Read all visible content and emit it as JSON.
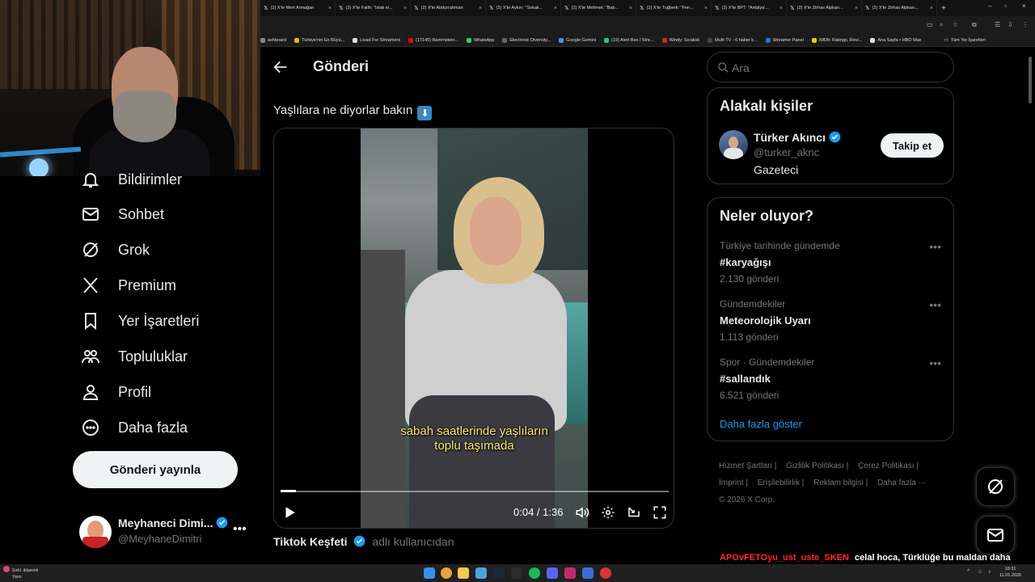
{
  "colors": {
    "background": "#000000",
    "text_primary": "#e7e9ea",
    "text_secondary": "#71767b",
    "accent": "#1d9bf0",
    "caption_yellow": "#f5e96b",
    "chat_user": "#ff2a2a"
  },
  "browser": {
    "tabs": [
      {
        "icon": "x-icon",
        "title": "(2) X'te Mert Armağan"
      },
      {
        "icon": "x-icon",
        "title": "(2) X'te Fatih: \"Islak ei..."
      },
      {
        "icon": "x-icon",
        "title": "(2) X'te Abdurrahman"
      },
      {
        "icon": "x-icon",
        "title": "(2) X'te Aykırı: \"Sokak..."
      },
      {
        "icon": "x-icon",
        "title": "(2) X'te Mehmet: \"Bab..."
      },
      {
        "icon": "x-icon",
        "title": "(2) X'te Tuğberk: \"Fen..."
      },
      {
        "icon": "x-icon",
        "title": "(2) X'te BPT: \"Antalya'..."
      },
      {
        "icon": "x-icon",
        "title": "(2) X'te Zirhas Alpkan..."
      },
      {
        "icon": "x-icon",
        "title": "(2) X'te Zirhas Alpkan..."
      }
    ],
    "bookmarks": [
      {
        "label": "ashboard",
        "color": "#888888"
      },
      {
        "label": "Türkiye'nin En Büyü...",
        "color": "#f5b400"
      },
      {
        "label": "Livad For Streamers",
        "color": "#dddddd"
      },
      {
        "label": "(17145) Rammstein...",
        "color": "#ff0000"
      },
      {
        "label": "WhatsApp",
        "color": "#25d366"
      },
      {
        "label": "Electronic Diversity...",
        "color": "#666666"
      },
      {
        "label": "Google Gemini",
        "color": "#4f8df5"
      },
      {
        "label": "(19) Alert Box / Stre...",
        "color": "#31c27c"
      },
      {
        "label": "Windy: Sıcaklık",
        "color": "#d22"
      },
      {
        "label": "Multi TV - 6 haber k...",
        "color": "#444444"
      },
      {
        "label": "Streamer Panel",
        "color": "#2a6de0"
      },
      {
        "label": "IMDb: Ratings, Revi...",
        "color": "#f5c518"
      },
      {
        "label": "Ana Sayfa • HBO Max",
        "color": "#dddddd"
      }
    ],
    "all_bookmarks_label": "Tüm Yer İşaretleri"
  },
  "nav": {
    "items": [
      {
        "label": "Bildirimler",
        "icon": "bell-icon"
      },
      {
        "label": "Sohbet",
        "icon": "mail-icon"
      },
      {
        "label": "Grok",
        "icon": "grok-icon"
      },
      {
        "label": "Premium",
        "icon": "x-logo-icon"
      },
      {
        "label": "Yer İşaretleri",
        "icon": "bookmark-icon"
      },
      {
        "label": "Topluluklar",
        "icon": "communities-icon"
      },
      {
        "label": "Profil",
        "icon": "person-icon"
      },
      {
        "label": "Daha fazla",
        "icon": "more-circle-icon"
      }
    ],
    "post_button": "Gönderi yayınla",
    "account": {
      "name": "Meyhaneci Dimi...",
      "handle": "@MeyhaneDimitri",
      "avatar_text": "DIMITRI"
    }
  },
  "main": {
    "title": "Gönderi",
    "tweet_text": "Yaşlılara ne diyorlar bakın",
    "tweet_emoji": "⬇",
    "video": {
      "caption_line1": "sabah saatlerinde yaşlıların",
      "caption_line2": "toplu taşımada",
      "time": "0:04 / 1:36",
      "progress": 0.04
    },
    "source": {
      "name": "Tiktok Keşfeti",
      "suffix": "adlı kullanıcıdan"
    }
  },
  "sidebar": {
    "search_placeholder": "Ara",
    "relevant": {
      "title": "Alakalı kişiler",
      "name": "Türker Akıncı",
      "handle": "@turker_aknc",
      "bio": "Gazeteci",
      "follow_label": "Takip et"
    },
    "trends": {
      "title": "Neler oluyor?",
      "items": [
        {
          "context": "Türkiye tarihinde gündemde",
          "name": "#karyağışı",
          "count": "2.130 gönderi"
        },
        {
          "context": "Gündemdekiler",
          "name": "Meteorolojik Uyarı",
          "count": "1.113 gönderi"
        },
        {
          "context": "Spor · Gündemdekiler",
          "name": "#sallandık",
          "count": "6.521 gönderi"
        }
      ],
      "show_more": "Daha fazla göster"
    },
    "footer": [
      "Hizmet Şartları |",
      "Gizlilik Politikası |",
      "Çerez Politikası |",
      "Imprint |",
      "Erişilebilirlik |",
      "Reklam bilgisi |",
      "Daha fazla ···",
      "© 2026 X Corp."
    ]
  },
  "chat": {
    "user": "APOvFETOyu_ust_uste_SKEN",
    "message": "celal hoca, Türklüğe bu maldan daha çok hizmet etmiştir"
  },
  "taskbar": {
    "weather_line1": "Sıckl. düşecek",
    "weather_line2": "Yarın",
    "time": "18:31",
    "date": "11.01.2026"
  }
}
